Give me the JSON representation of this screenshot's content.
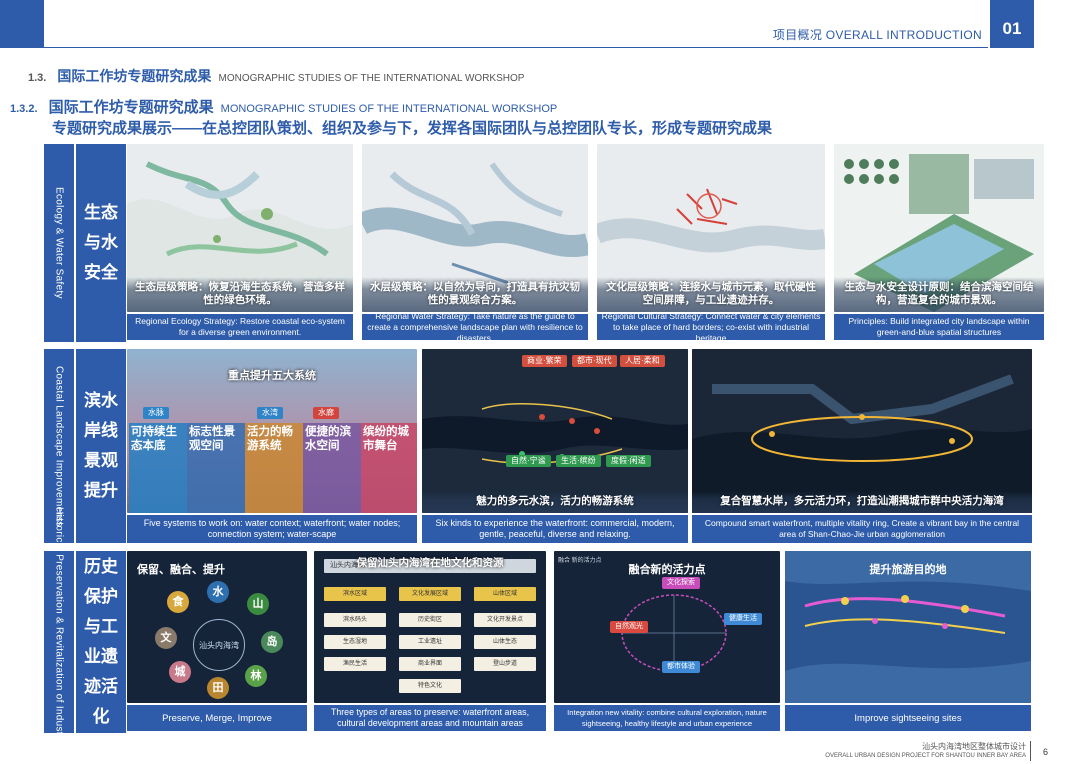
{
  "header": {
    "title": "项目概况 OVERALL INTRODUCTION",
    "chapter_number": "01"
  },
  "section": {
    "line1_num": "1.3.",
    "line1_cn": "国际工作坊专题研究成果",
    "line1_en": "MONOGRAPHIC STUDIES OF THE INTERNATIONAL WORKSHOP",
    "line2_num": "1.3.2.",
    "line2_cn": "国际工作坊专题研究成果",
    "line2_en": "MONOGRAPHIC STUDIES OF THE INTERNATIONAL WORKSHOP",
    "subtitle": "专题研究成果展示——在总控团队策划、组织及参与下，发挥各国际团队与总控团队专长，形成专题研究成果"
  },
  "rows": [
    {
      "en_label": "Ecology & Water Safety",
      "cn_label": "生态与水安全",
      "panels": [
        {
          "overlay": "生态层级策略：恢复沿海生态系统，营造多样性的绿色环境。",
          "caption": "Regional Ecology Strategy: Restore coastal eco-system for a diverse green environment."
        },
        {
          "overlay": "水层级策略：以自然为导向，打造具有抗灾韧性的景观综合方案。",
          "caption": "Regional Water Strategy: Take nature as the guide to create a comprehensive landscape plan with resilience to disasters."
        },
        {
          "overlay": "文化层级策略：连接水与城市元素，取代硬性空间屏障，与工业遗迹并存。",
          "caption": "Regional Cultural Strategy: Connect water & city elements to take place of hard borders; co-exist with industrial heritage"
        },
        {
          "overlay": "生态与水安全设计原则：结合滨海空间结构，营造复合的城市景观。",
          "caption": "Principles: Build integrated city landscape within green-and-blue spatial structures"
        }
      ]
    },
    {
      "en_label": "Coastal Landscape Improvements",
      "cn_label": "滨水岸线景观提升",
      "panels": [
        {
          "overlay": "重点提升五大系统",
          "caption": "Five systems to work on: water context; waterfront; water nodes; connection system; water-scape",
          "tags": [
            "水脉",
            "水湾",
            "水廊"
          ],
          "systems": [
            {
              "title": "可持续生态本底",
              "color": "#2e7fc1"
            },
            {
              "title": "标志性景观空间",
              "color": "#3c6fb0"
            },
            {
              "title": "活力的畅游系统",
              "color": "#c8883a"
            },
            {
              "title": "便捷的滨水空间",
              "color": "#7a5aa0"
            },
            {
              "title": "缤纷的城市舞台",
              "color": "#c44a6b"
            }
          ]
        },
        {
          "overlay": "魅力的多元水滨，活力的畅游系统",
          "caption": "Six kinds to experience the waterfront: commercial, modern, gentle, peaceful, diverse and relaxing.",
          "tags_top": [
            "商业·繁荣",
            "都市·现代",
            "人居·柔和"
          ],
          "tags_bottom": [
            "自然·宁谧",
            "生活·缤纷",
            "度假·闲适"
          ]
        },
        {
          "overlay": "复合智慧水岸，多元活力环，打造汕潮揭城市群中央活力海湾",
          "caption": "Compound smart waterfront, multiple vitality ring, Create a vibrant bay in the central area of Shan-Chao-Jie urban agglomeration"
        }
      ]
    },
    {
      "en_label": "Historical Preservation & Revitalization of Industrial Sites",
      "cn_label": "历史保护与工业遗迹活化",
      "panels": [
        {
          "overlay": "保留、融合、提升",
          "caption": "Preserve, Merge, Improve",
          "center": "汕头内海湾",
          "satellites": [
            "水",
            "山",
            "岛",
            "林",
            "田",
            "城",
            "文",
            "食"
          ]
        },
        {
          "overlay": "保留汕头内海湾在地文化和资源",
          "caption": "Three types of areas to preserve: waterfront areas, cultural development areas and mountain areas",
          "header_strip": "汕头内海湾",
          "boxes": [
            "滨水区域",
            "文化发展区域",
            "山体区域",
            "滨水码头",
            "历史街区",
            "文化开发景点",
            "生态湿地",
            "工业遗址",
            "山体生态",
            "渔民生活",
            "商业界面",
            "登山步道",
            "特色文化"
          ]
        },
        {
          "overlay": "融合新的活力点",
          "caption": "Integration new vitality: combine cultural exploration, nature sightseeing, healthy lifestyle and urban experience",
          "corner_label": "融合 新的活力点",
          "nodes": [
            "文化探索",
            "健康生活",
            "自然观光",
            "都市体验"
          ]
        },
        {
          "overlay": "提升旅游目的地",
          "caption": "Improve sightseeing sites"
        }
      ]
    }
  ],
  "footer": {
    "cn": "汕头内海湾地区整体城市设计",
    "en": "OVERALL URBAN DESIGN PROJECT FOR SHANTOU INNER BAY AREA",
    "page": "6"
  },
  "colors": {
    "brand_blue": "#2e5caa",
    "dark_navy": "#16243a"
  }
}
